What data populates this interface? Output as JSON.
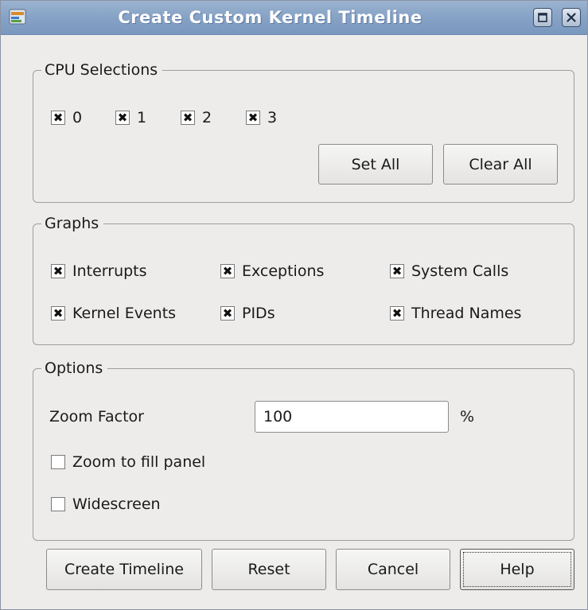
{
  "window": {
    "title": "Create Custom Kernel Timeline",
    "icons": [
      "app-icon",
      "maximize-icon",
      "close-icon"
    ]
  },
  "cpu_selections": {
    "legend": "CPU Selections",
    "cpus": [
      {
        "label": "0",
        "checked": true
      },
      {
        "label": "1",
        "checked": true
      },
      {
        "label": "2",
        "checked": true
      },
      {
        "label": "3",
        "checked": true
      }
    ],
    "set_all_label": "Set All",
    "clear_all_label": "Clear All"
  },
  "graphs": {
    "legend": "Graphs",
    "items": [
      {
        "label": "Interrupts",
        "checked": true
      },
      {
        "label": "Exceptions",
        "checked": true
      },
      {
        "label": "System Calls",
        "checked": true
      },
      {
        "label": "Kernel Events",
        "checked": true
      },
      {
        "label": "PIDs",
        "checked": true
      },
      {
        "label": "Thread Names",
        "checked": true
      }
    ]
  },
  "options": {
    "legend": "Options",
    "zoom_factor_label": "Zoom Factor",
    "zoom_factor_value": "100",
    "percent_label": "%",
    "zoom_to_fill": {
      "label": "Zoom to fill panel",
      "checked": false
    },
    "widescreen": {
      "label": "Widescreen",
      "checked": false
    }
  },
  "buttons": {
    "create": "Create Timeline",
    "reset": "Reset",
    "cancel": "Cancel",
    "help": "Help"
  }
}
